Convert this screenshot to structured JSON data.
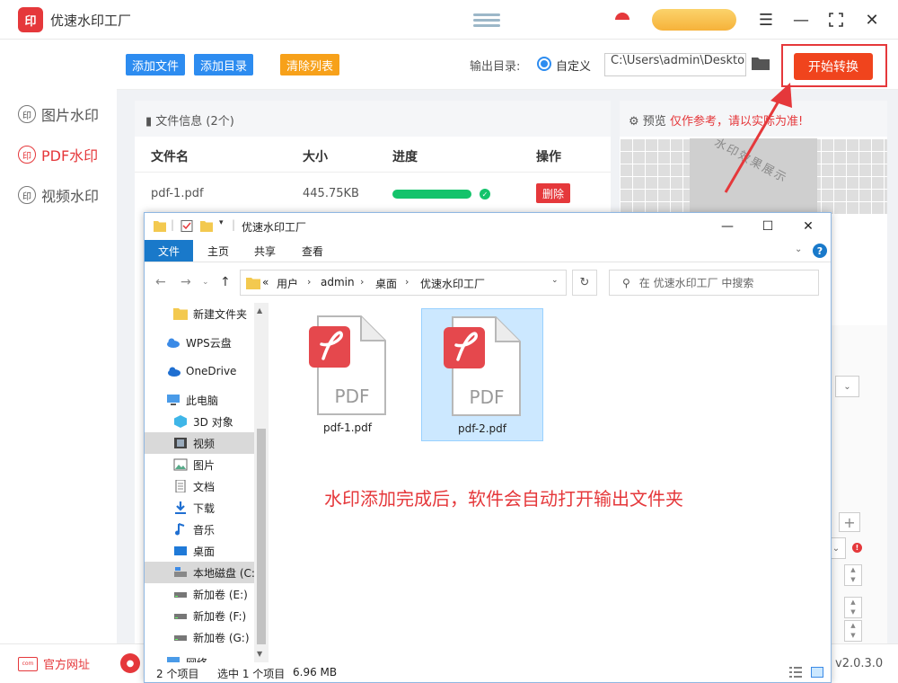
{
  "app": {
    "logo": "印",
    "title": "优速水印工厂",
    "version": "v2.0.3.0",
    "accent": "#e5383b"
  },
  "sidebar": {
    "items": [
      {
        "label": "图片水印",
        "active": false
      },
      {
        "label": "PDF水印",
        "active": true
      },
      {
        "label": "视频水印",
        "active": false
      }
    ]
  },
  "toolbar": {
    "add_file": "添加文件",
    "add_dir": "添加目录",
    "clear_list": "清除列表",
    "output_label": "输出目录:",
    "custom_option": "自定义",
    "output_path": "C:\\Users\\admin\\Desktop",
    "start": "开始转换"
  },
  "file_panel": {
    "header": "文件信息 (2个)",
    "columns": [
      "文件名",
      "大小",
      "进度",
      "操作"
    ],
    "rows": [
      {
        "name": "pdf-1.pdf",
        "size": "445.75KB",
        "progress": 1.0,
        "action": "删除"
      }
    ]
  },
  "preview": {
    "label": "预览",
    "warning": "仅作参考，请以实际为准!",
    "watermark_text": "水印效果展示"
  },
  "bottom": {
    "site": "官方网址",
    "site_icon_text": "com"
  },
  "explorer": {
    "title": "优速水印工厂",
    "ribbon_tabs": [
      "文件",
      "主页",
      "共享",
      "查看"
    ],
    "breadcrumb": [
      "用户",
      "admin",
      "桌面",
      "优速水印工厂"
    ],
    "breadcrumb_prefix": "«",
    "search_placeholder": "在 优速水印工厂 中搜索",
    "nav_items": [
      {
        "label": "新建文件夹",
        "icon": "folder-icon"
      },
      {
        "label": "WPS云盘",
        "icon": "cloud-icon"
      },
      {
        "label": "OneDrive",
        "icon": "onedrive-icon"
      },
      {
        "label": "此电脑",
        "icon": "computer-icon"
      },
      {
        "label": "3D 对象",
        "icon": "cube-icon"
      },
      {
        "label": "视频",
        "icon": "video-icon"
      },
      {
        "label": "图片",
        "icon": "picture-icon"
      },
      {
        "label": "文档",
        "icon": "document-icon"
      },
      {
        "label": "下载",
        "icon": "download-icon"
      },
      {
        "label": "音乐",
        "icon": "music-icon"
      },
      {
        "label": "桌面",
        "icon": "desktop-icon"
      },
      {
        "label": "本地磁盘 (C:)",
        "icon": "drive-icon"
      },
      {
        "label": "新加卷 (E:)",
        "icon": "drive-icon"
      },
      {
        "label": "新加卷 (F:)",
        "icon": "drive-icon"
      },
      {
        "label": "新加卷 (G:)",
        "icon": "drive-icon"
      },
      {
        "label": "网络",
        "icon": "network-icon"
      }
    ],
    "files": [
      {
        "name": "pdf-1.pdf",
        "selected": false
      },
      {
        "name": "pdf-2.pdf",
        "selected": true
      }
    ],
    "pdf_label": "PDF",
    "annotation": "水印添加完成后，软件会自动打开输出文件夹",
    "status": {
      "count": "2 个项目",
      "selection": "选中 1 个项目",
      "size": "6.96 MB"
    }
  }
}
